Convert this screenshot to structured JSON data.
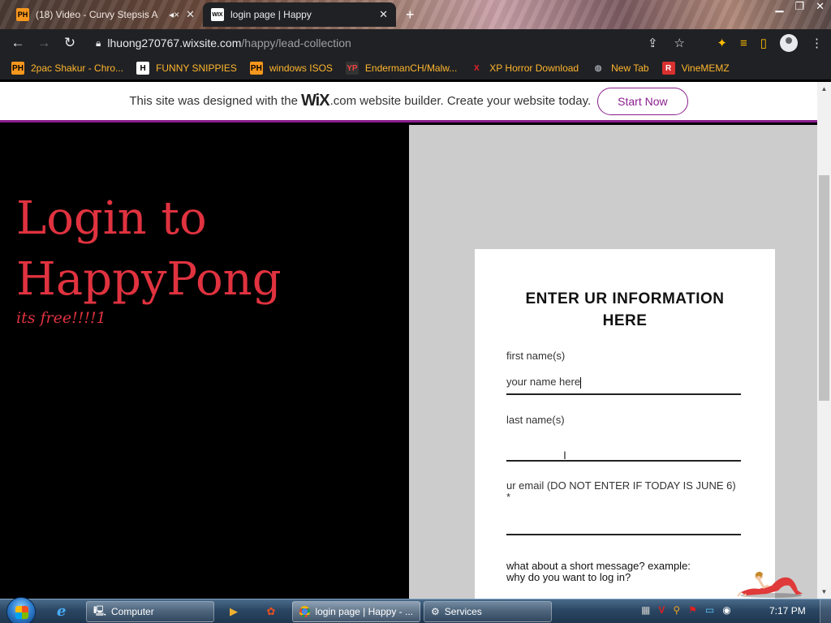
{
  "tabs": {
    "inactive": {
      "favicon": "PH",
      "title": "(18) Video - Curvy Stepsis A"
    },
    "active": {
      "favicon": "WIX",
      "title": "login page | Happy"
    },
    "close_glyph": "✕",
    "new_tab_glyph": "+"
  },
  "toolbar": {
    "url_host": "lhuong270767.wixsite.com",
    "url_path": "/happy/lead-collection"
  },
  "bookmarks": [
    {
      "label": "2pac Shakur - Chro...",
      "icon": "PH",
      "icon_bg": "#f7971d",
      "icon_fg": "#000"
    },
    {
      "label": "FUNNY SNIPPIES",
      "icon": "H",
      "icon_bg": "#fff",
      "icon_fg": "#000"
    },
    {
      "label": "windows ISOS",
      "icon": "PH",
      "icon_bg": "#f7971d",
      "icon_fg": "#000"
    },
    {
      "label": "EndermanCH/Malw...",
      "icon": "YP",
      "icon_bg": "#333",
      "icon_fg": "#e44"
    },
    {
      "label": "XP Horror Download",
      "icon": "X",
      "icon_bg": "transparent",
      "icon_fg": "#e8222c"
    },
    {
      "label": "New Tab",
      "icon": "◍",
      "icon_bg": "transparent",
      "icon_fg": "#9aa0a6"
    },
    {
      "label": "VineMEMZ",
      "icon": "R",
      "icon_bg": "#d93030",
      "icon_fg": "#fff"
    }
  ],
  "wix_banner": {
    "text_before": "This site was designed with the",
    "logo": "WiX",
    "text_after": ".com website builder. Create your website today.",
    "button_label": "Start Now"
  },
  "hero": {
    "title": "Login to HappyPong",
    "subtitle": "its free!!!!1"
  },
  "form": {
    "heading": "ENTER UR INFORMATION HERE",
    "first_name_label": "first name(s)",
    "first_name_value": "your name here",
    "last_name_label": "last name(s)",
    "last_name_value": "",
    "email_label": "ur email (DO NOT ENTER IF TODAY IS JUNE 6) *",
    "email_value": "",
    "message_label_line1": "what about a short message? example:",
    "message_label_line2": "why do you want to log in?"
  },
  "taskbar": {
    "computer_label": "Computer",
    "chrome_label": "login page | Happy - ...",
    "services_label": "Services",
    "clock": "7:17 PM"
  }
}
